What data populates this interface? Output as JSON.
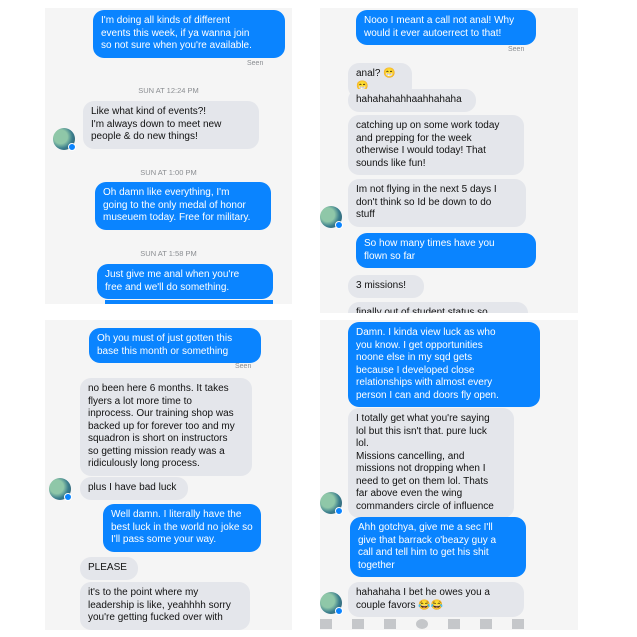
{
  "colors": {
    "sent": "#0a84ff",
    "received": "#e4e6eb",
    "background": "#f5f5f5"
  },
  "panel1": {
    "msg1": "I'm doing all kinds of different\nevents this week, if ya wanna join\nso not sure when you're available.",
    "seen": "Seen",
    "time1": "SUN AT 12:24 PM",
    "msg2": "Like what kind of events?!\nI'm always down to meet new\npeople & do new things!",
    "time2": "SUN AT 1:00 PM",
    "msg3": "Oh damn like everything, I'm\ngoing to the only medal of honor\nmuseuem today. Free for military.",
    "time3": "SUN AT 1:58 PM",
    "msg4": "Just give me anal when you're\nfree and we'll do something."
  },
  "panel2": {
    "msg1": "Nooo I meant a call not anal! Why\nwould it ever autoerrect to that!",
    "seen": "Seen",
    "msg2": "anal? 😁😁",
    "msg3": "hahahahahhaahhahaha",
    "msg4": "catching up on some work today\nand prepping for the week\notherwise I would today! That\nsounds like fun!",
    "msg5": "Im not flying in the next 5 days I\ndon't think so Id be down to do\nstuff",
    "msg6": "So how many times have you\nflown so far",
    "msg7": "3 missions!",
    "msg8": "finally out of student status so"
  },
  "panel3": {
    "msg1": "Oh you must of just gotten this\nbase this month or something",
    "seen": "Seen",
    "msg2": "no been here 6 months. It takes\nflyers  a lot more time to\ninprocess. Our training shop was\nbacked up for forever too and my\nsquadron is short on instructors\nso getting mission ready was a\nridiculously long process.",
    "msg3": "plus I have bad luck",
    "msg4": "Well damn. I literally have the\nbest luck in the world no joke so\nI'll pass some your way.",
    "msg5": "PLEASE",
    "msg6": "it's to the point where my\nleadership is like, yeahhhh sorry\nyou're getting fucked over with"
  },
  "panel4": {
    "msg1": "Damn. I kinda view luck as who\nyou know. I get opportunities\nnoone else in my sqd gets\nbecause I developed close\nrelationships with almost every\nperson I can and doors fly open.",
    "msg2": "I totally get what you're saying\nlol but this isn't that. pure luck\nlol.\nMissions cancelling, and\nmissions not dropping when I\nneed to get on them lol. Thats\nfar above even the wing\ncommanders circle of influence",
    "msg3": "Ahh gotchya, give me a sec I'll\ngive that barrack o'beazy guy a\ncall and tell him to get his shit\ntogether",
    "msg4": "hahahaha I bet he owes you a\ncouple favors 😂😂"
  }
}
